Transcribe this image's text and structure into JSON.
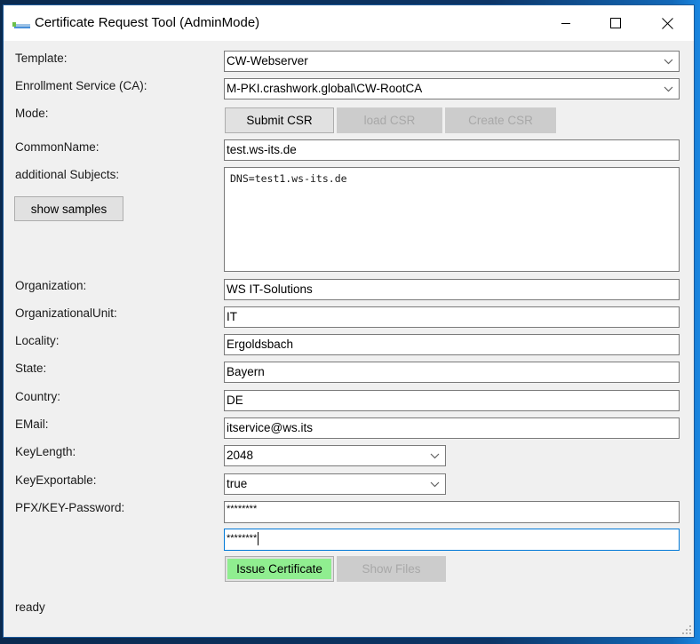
{
  "window": {
    "title": "Certificate Request Tool (AdminMode)",
    "controls": {
      "minimize": "minimize",
      "maximize": "maximize",
      "close": "close"
    }
  },
  "form": {
    "template": {
      "label": "Template:",
      "value": "CW-Webserver"
    },
    "enrollment_service": {
      "label": "Enrollment Service (CA):",
      "value": "M-PKI.crashwork.global\\CW-RootCA"
    },
    "mode": {
      "label": "Mode:",
      "buttons": [
        {
          "label": "Submit CSR",
          "enabled": true
        },
        {
          "label": "load CSR",
          "enabled": false
        },
        {
          "label": "Create CSR",
          "enabled": false
        }
      ]
    },
    "common_name": {
      "label": "CommonName:",
      "value": "test.ws-its.de"
    },
    "additional_subjects": {
      "label": "additional Subjects:",
      "value": "DNS=test1.ws-its.de",
      "samples_button": "show samples"
    },
    "organization": {
      "label": "Organization:",
      "value": "WS IT-Solutions"
    },
    "organizational_unit": {
      "label": "OrganizationalUnit:",
      "value": "IT"
    },
    "locality": {
      "label": "Locality:",
      "value": "Ergoldsbach"
    },
    "state": {
      "label": "State:",
      "value": "Bayern"
    },
    "country": {
      "label": "Country:",
      "value": "DE"
    },
    "email": {
      "label": "EMail:",
      "value": "itservice@ws.its"
    },
    "key_length": {
      "label": "KeyLength:",
      "value": "2048"
    },
    "key_exportable": {
      "label": "KeyExportable:",
      "value": "true"
    },
    "password": {
      "label": "PFX/KEY-Password:",
      "value": "********",
      "confirm_value": "********"
    }
  },
  "actions": {
    "issue_certificate": "Issue Certificate",
    "show_files": "Show Files"
  },
  "colors": {
    "issue_button": "#90ee90",
    "focus_border": "#0078d7"
  },
  "status": "ready"
}
